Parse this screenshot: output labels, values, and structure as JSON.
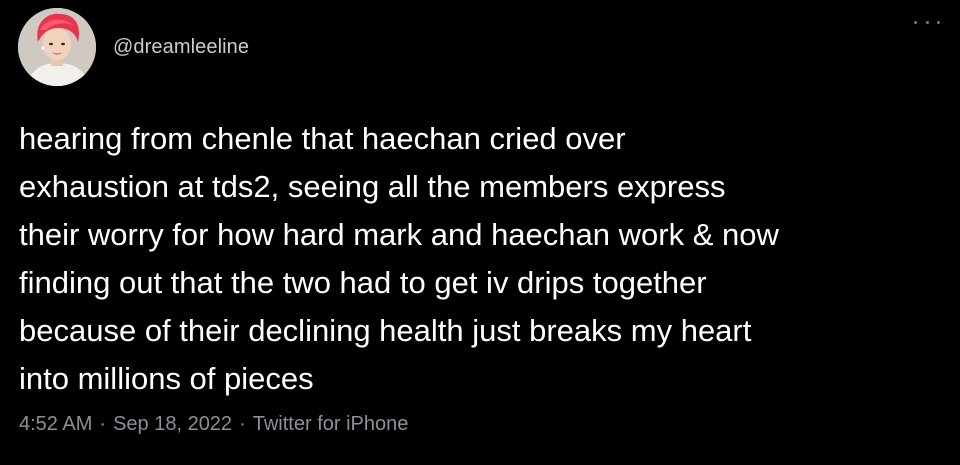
{
  "tweet": {
    "handle": "@dreamleeline",
    "text": "hearing from chenle that haechan cried over\nexhaustion at tds2, seeing all the members express\ntheir worry for how hard mark and haechan work & now\nfinding out that the two had to get iv drips together\nbecause of their declining health just breaks my heart\ninto millions of pieces",
    "time": "4:52 AM",
    "separator": "·",
    "date": "Sep 18, 2022",
    "source": "Twitter for iPhone"
  },
  "icons": {
    "more": "more-horizontal-icon"
  },
  "colors": {
    "background": "#000000",
    "text": "#ffffff",
    "secondary": "#8b9096",
    "avatar_hair": "#e8354f"
  }
}
